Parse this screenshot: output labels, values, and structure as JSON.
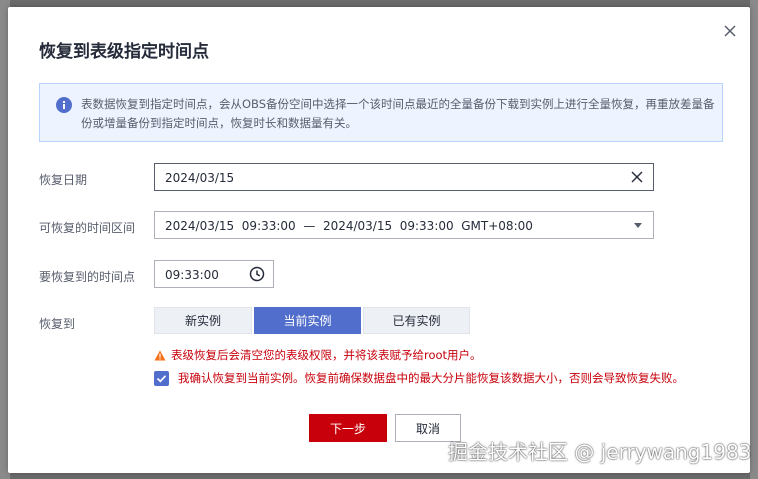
{
  "dialog": {
    "title": "恢复到表级指定时间点",
    "close_icon": "close-icon"
  },
  "info": {
    "icon": "info-icon",
    "text": "表数据恢复到指定时间点，会从OBS备份空间中选择一个该时间点最近的全量备份下载到实例上进行全量恢复，再重放差量备份或增量备份到指定时间点，恢复时长和数据量有关。"
  },
  "form": {
    "date_label": "恢复日期",
    "date_value": "2024/03/15",
    "range_label": "可恢复的时间区间",
    "range_value": "2024/03/15  09:33:00  —  2024/03/15  09:33:00  GMT+08:00",
    "time_label": "要恢复到的时间点",
    "time_value": "09:33:00",
    "target_label": "恢复到",
    "target_options": [
      "新实例",
      "当前实例",
      "已有实例"
    ],
    "target_selected": "当前实例",
    "warning": "表级恢复后会清空您的表级权限，并将该表赋予给root用户。",
    "confirm_text": "我确认恢复到当前实例。恢复前确保数据盘中的最大分片能恢复该数据大小，否则会导致恢复失败。",
    "confirm_checked": true
  },
  "buttons": {
    "next": "下一步",
    "cancel": "取消"
  },
  "watermark": "掘金技术社区 @ jerrywang1983",
  "colors": {
    "primary": "#526ecc",
    "danger": "#c7000b",
    "info_bg": "#edf4ff",
    "warning_icon": "#f66f1a"
  }
}
